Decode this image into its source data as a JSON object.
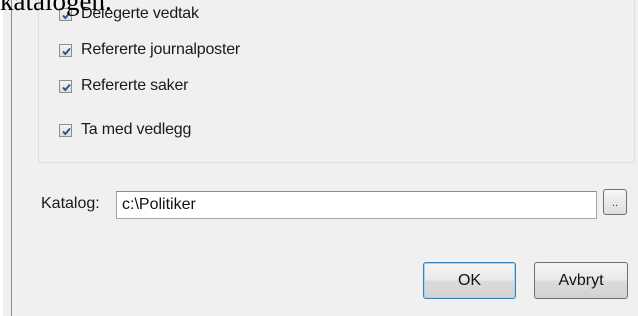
{
  "caption": "katalogen.",
  "options": {
    "items": [
      {
        "label": "Delegerte vedtak",
        "checked": true
      },
      {
        "label": "Refererte journalposter",
        "checked": true
      },
      {
        "label": "Refererte saker",
        "checked": true
      },
      {
        "label": "Ta med vedlegg",
        "checked": true
      }
    ]
  },
  "catalog": {
    "label": "Katalog:",
    "value": "c:\\Politiker",
    "browse_label": ".."
  },
  "buttons": {
    "ok": "OK",
    "cancel": "Avbryt"
  }
}
